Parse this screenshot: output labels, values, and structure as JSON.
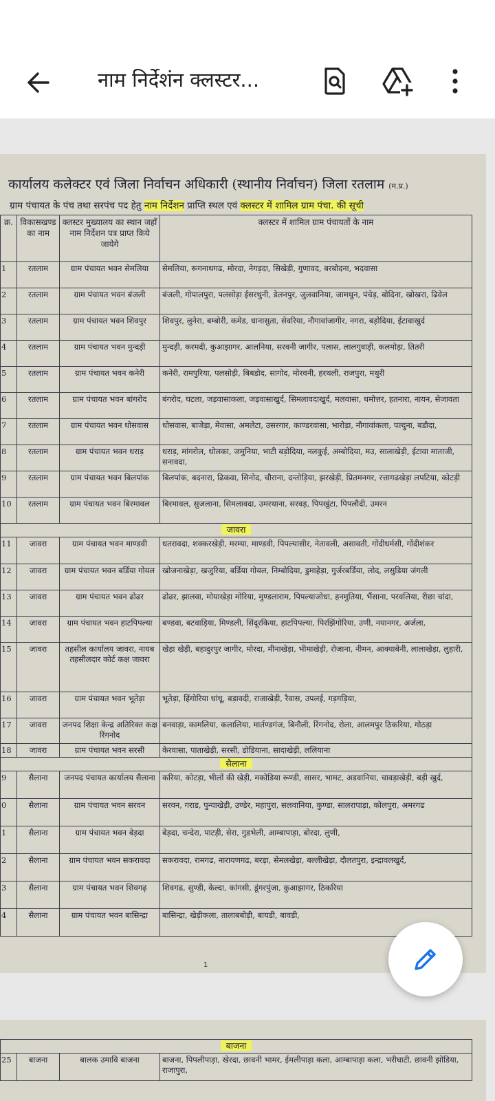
{
  "appbar": {
    "title": "नाम निर्देशंन क्लस्टर...",
    "icons": [
      "arrow-back-icon",
      "search-document-icon",
      "add-to-drive-icon",
      "more-vert-icon"
    ]
  },
  "document": {
    "heading": "कार्यालय कलेक्टर एवं जिला निर्वाचन अधिकारी (स्थानीय निर्वाचन) जिला रतलाम",
    "heading_suffix": "(म.प्र.)",
    "subheading_a": "ग्राम पंचायत के पंच तथा सरपंच पद हेतु",
    "subheading_hl1": "नाम निर्देशन",
    "subheading_b": "प्राप्ति स्थल एवं",
    "subheading_hl2": "क्लस्टर में शामिल ग्राम पंचा. की सूची",
    "columns": [
      "क्र.",
      "विकासखण्ड का नाम",
      "क्लस्टर मुख्यालय का स्थान जहाँ नाम निर्देशन पत्र प्राप्त किये जायेगे",
      "क्लस्टर में शामिल ग्राम पंचायतों के नाम"
    ],
    "rows_ratlam": [
      {
        "n": "1",
        "block": "रतलाम",
        "hq": "ग्राम पंचायत भवन सेमलिया",
        "gps": "सेमलिया, रूगनाथगढ, मोरदा, नेगड़दा, सिखेड़ी, गुणावद, बरबोदना, भदवासा"
      },
      {
        "n": "2",
        "block": "रतलाम",
        "hq": "ग्राम पंचायत भवन बंजली",
        "gps": "बंजली, गोपालपुरा, पलसोड़ा ईसरथुनी, डेलनपुर, जुलवानिया, जामथुन, पंचेड़, बोदिना, खोखरा, ढिवेल"
      },
      {
        "n": "3",
        "block": "रतलाम",
        "hq": "ग्राम पंचायत भवन शिवपुर",
        "gps": "शिवपुर, लुनेरा, बम्बोरी, कमेड, धानासुता, सेवरिया, नौगावांजागीर, नगरा, बड़ोदिया, ईटावाखुर्द"
      },
      {
        "n": "4",
        "block": "रतलाम",
        "hq": "ग्राम पंचायत भवन मुन्दड़ी",
        "gps": "मुन्दड़ी, करमदी, कुआझागर, आलनिया, सरवनी जागीर, पलास, लालगुवाड़ी, कलमोड़ा, तितरी"
      },
      {
        "n": "5",
        "block": "रतलाम",
        "hq": "ग्राम पंचायत भवन कनेरी",
        "gps": "कनेरी, रामपुरिया, पलसोड़ी, बिबडोद, सागोद, मोरवनी, हरथली, राजपुरा, मथुरी"
      },
      {
        "n": "6",
        "block": "रतलाम",
        "hq": "ग्राम पंचायत भवन बांगरोद",
        "gps": "बंगरोद, घटला, जड़वासाकला, जड़वासाखुर्द, सिमलावदाखुर्द, मलवासा, धमोत्तर, हतनारा, नायन, सेजावता"
      },
      {
        "n": "7",
        "block": "रतलाम",
        "hq": "ग्राम पंचायत भवन धोसवास",
        "gps": "धोसवास, बाजेड़ा, मेवासा, अमलेटा, उसरगार, काण्डरवासा, भारोड़ा, नौगावांकला, पल्दुना, बडौदा,"
      },
      {
        "n": "8",
        "block": "रतलाम",
        "hq": "ग्राम पंचायत भवन धराड़",
        "gps": "धराड़, मांगरोल, धोलका, जमुनिया, भाटी बड़ोदिया, नलकुई, अम्बोदिया, मउ, सालाखेड़ी, ईटावा माताजी, सनावदा,"
      },
      {
        "n": "9",
        "block": "रतलाम",
        "hq": "ग्राम पंचायत भवन बिलपांक",
        "gps": "बिलपांक, बदनारा, ढिकवा, सिनोद, चौराना, दन्तोड़िया, झरखेड़ी, प्रितमनगर, रत्तागढखेड़ा लपटिया, कोटड़ी"
      },
      {
        "n": "10",
        "block": "रतलाम",
        "hq": "ग्राम पंचायत भवन बिरमावल",
        "gps": "बिरमावल, सुजलाना, सिमलावदा, उमरथाना, सरवड़, पिपखुंटा, पिपलौदी, उमरन"
      }
    ],
    "section_jaora": "जावरा",
    "rows_jaora": [
      {
        "n": "11",
        "block": "जावरा",
        "hq": "ग्राम पंचायत भवन माण्डवी",
        "gps": "धतरावदा, शक्करखेड़ी, मरम्या, माण्डवी, पिपल्यासीर, नेतावली, असावती, गोंदीधर्मसी, गोंदीशंकर"
      },
      {
        "n": "12",
        "block": "जावरा",
        "hq": "ग्राम पंचायत भवन बर्डिया गोयल",
        "gps": "खोजनाखेड़ा, खजुरिया, बर्डिया गोयल, निम्बोदिया, डुमाहेड़ा, गुर्जरबर्डिया, लोद, लसुडिया जंगली"
      },
      {
        "n": "13",
        "block": "जावरा",
        "hq": "ग्राम पंचायत भवन ढोढर",
        "gps": "ढोढर, झालवा, मोयाखेड़ा मोरिया, मुण्डलाराम, पिपल्याजोधा, हनमुतिया, भैंसाना, परवलिया, रीछा चांदा,"
      },
      {
        "n": "14",
        "block": "जावरा",
        "hq": "ग्राम पंचायत भवन हाटपिपल्या",
        "gps": "बण्डवा, बटवाड़िया, मिण्डली, सिंदूरकिया, हाटपिपल्या, पिरझिंगोरिया, उणी, नयानगर, अर्जला,"
      },
      {
        "n": "15",
        "block": "जावरा",
        "hq": "तहसील कार्यालय जावरा, नायब तहसीलदार कोर्ट कक्ष जावरा",
        "gps": "खेड़ा खेड़ी, बहादुरपुर जागीर, मोरदा, मीनाखेड़ा, भीमाखेड़ी, रोजाना, नीमन, आक्याबेनी, लालाखेड़ा, लुहारी,"
      },
      {
        "n": "16",
        "block": "जावरा",
        "hq": "ग्राम पंचायत भवन भूतेड़ा",
        "gps": "भूतेड़ा, हिंगोरिया धांधू, बड़ावदी, राजाखेड़ी, रैवास, उपलई, गड़गड़िया,"
      },
      {
        "n": "17",
        "block": "जावरा",
        "hq": "जनपद शिक्षा केन्द्र अतिरिक्त कक्ष रिंगनोद",
        "gps": "बनवाड़ा, कामलिया, कलालिया, मार्तण्डगंज, बिनौली, रिंगनोद, रोला, आलमपुर ठिकरिया, गोठड़ा"
      },
      {
        "n": "18",
        "block": "जावरा",
        "hq": "ग्राम पंचायत भवन सरसी",
        "gps": "केरवासा, पाताखेड़ी, सरसी, डोडियाना, सादाखेड़ी, ललियाना"
      }
    ],
    "section_sailana": "सैलाना",
    "rows_sailana": [
      {
        "n": "9",
        "block": "सैलाना",
        "hq": "जनपद पंचायत कार्यालय सैलाना",
        "gps": "करिया, कोटड़ा, भीलों की खेड़ी, मकोडिया रूण्डी, सासर, भामट, अडवानिया, चावड़ाखेड़ी, बड़ी खुर्द,"
      },
      {
        "n": "0",
        "block": "सैलाना",
        "hq": "ग्राम पंचायत भवन सरवन",
        "gps": "सरवन, गराड, पुन्याखेड़ी, उण्डेर, महापुरा, सलवानिया, कुण्डा, सालरापाड़ा, कोलपुरा, अमरगढ"
      },
      {
        "n": "1",
        "block": "सैलाना",
        "hq": "ग्राम पंचायत भवन बेड़दा",
        "gps": "बेड़दा, चन्देरा, पाटड़ी, सेरा, गुडभेली, आम्बापाड़ा, बोरदा, लुणी,"
      },
      {
        "n": "2",
        "block": "सैलाना",
        "hq": "ग्राम पंचायत भवन सकरावदा",
        "gps": "सकरावदा, रामगढ, नारायणगढ, बरड़ा, सेमलखेड़ा, बल्लीखेड़ा, दौलतपुरा, इन्द्रावलखुर्द,"
      },
      {
        "n": "3",
        "block": "सैलाना",
        "hq": "ग्राम पंचायत भवन शिवगढ़",
        "gps": "शिवगढ, सुण्डी, केल्दा, कांगसी, डूंगरपुंजा, कुआझागर, ठिकरिया"
      },
      {
        "n": "4",
        "block": "सैलाना",
        "hq": "ग्राम पंचायत भवन बासिन्द्रा",
        "gps": "बासिन्द्रा, खेड़ीकला, तालाबबोड़ी, बायडी, बावडी,"
      }
    ],
    "page_number": "1",
    "section_bajna": "बाजना",
    "rows_bajna": [
      {
        "n": "25",
        "block": "बाजना",
        "hq": "बालक उमावि बाजना",
        "gps": "बाजना, पिपलीपाड़ा, खेरदा, छावनी भामर, ईमलीपाड़ा कला, आम्बापाड़ा कला, भरीघाटी, छावनी झोडिया, राजापुरा,"
      }
    ]
  },
  "fab": {
    "icon": "edit-pencil-icon"
  }
}
